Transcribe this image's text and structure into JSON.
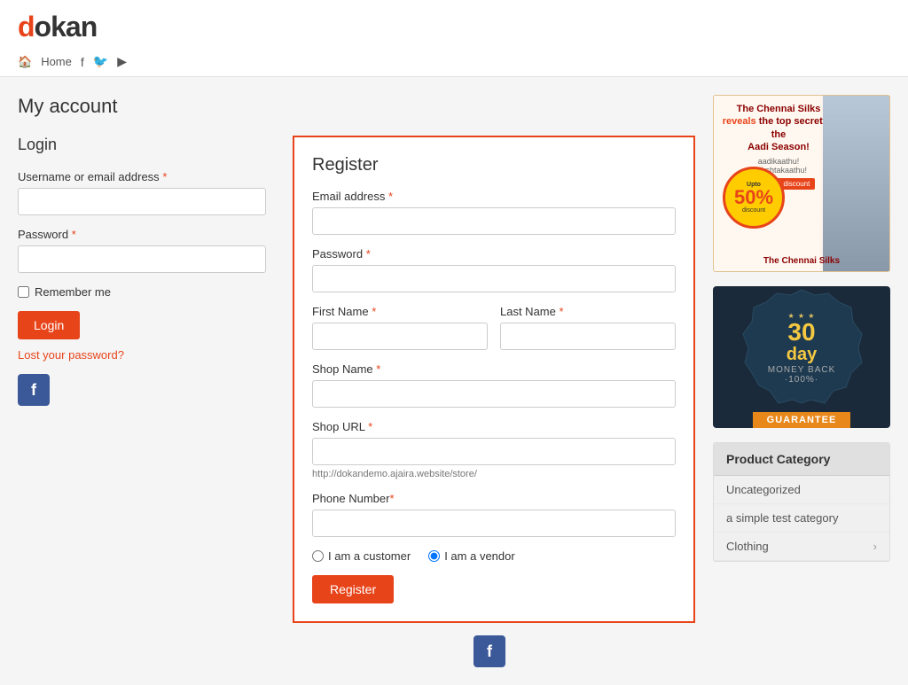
{
  "site": {
    "logo": "dokan",
    "logo_first_letter": "d"
  },
  "nav": {
    "home": "Home",
    "home_icon": "🏠",
    "facebook_icon": "f",
    "twitter_icon": "t",
    "youtube_icon": "▶"
  },
  "page": {
    "title": "My account"
  },
  "login": {
    "section_title": "Login",
    "username_label": "Username or email address",
    "password_label": "Password",
    "remember_label": "Remember me",
    "login_button": "Login",
    "lost_password": "Lost your password?"
  },
  "register": {
    "section_title": "Register",
    "email_label": "Email address",
    "password_label": "Password",
    "first_name_label": "First Name",
    "last_name_label": "Last Name",
    "shop_name_label": "Shop Name",
    "shop_url_label": "Shop URL",
    "shop_url_hint": "http://dokandemo.ajaira.website/store/",
    "phone_label": "Phone Number",
    "customer_label": "I am a customer",
    "vendor_label": "I am a vendor",
    "register_button": "Register"
  },
  "sidebar": {
    "ad_headline": "The Chennai Silks reveals the top secret of the Aadi Season!",
    "guarantee": {
      "days": "30",
      "day_label": "day",
      "money_back": "MONEY BACK",
      "guarantee_label": "GUARANTEE",
      "percent": "·100%·"
    },
    "product_category": {
      "title": "Product Category",
      "items": [
        {
          "label": "Uncategorized",
          "has_arrow": false
        },
        {
          "label": "a simple test category",
          "has_arrow": false
        },
        {
          "label": "Clothing",
          "has_arrow": true
        }
      ]
    }
  }
}
